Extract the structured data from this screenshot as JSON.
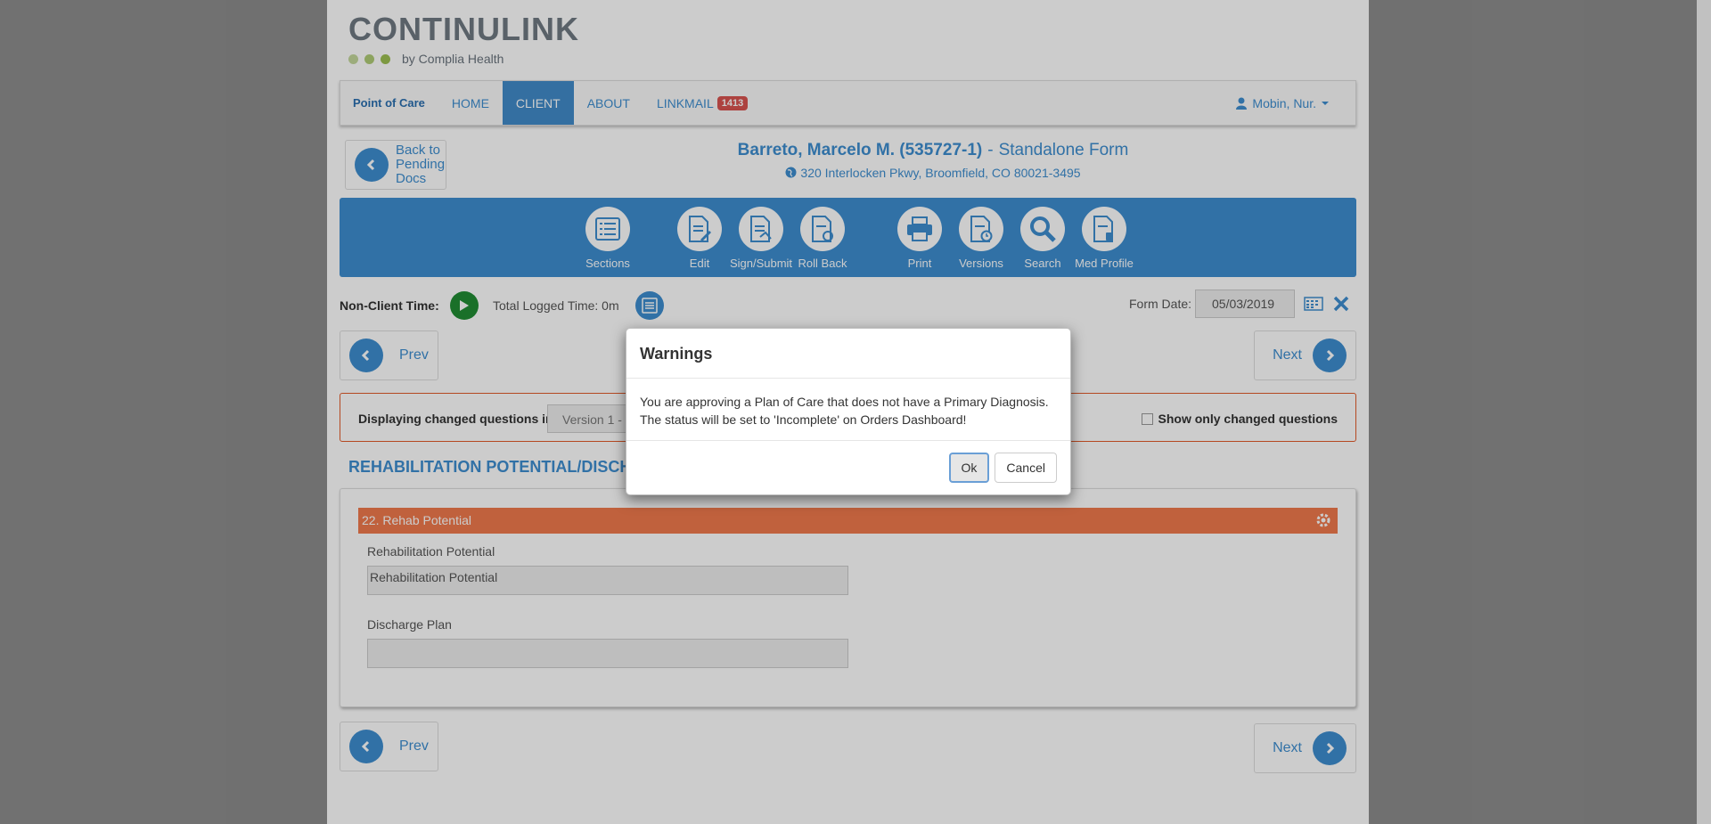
{
  "logo": {
    "name": "CONTINULINK",
    "by": "by Complia Health",
    "dot_colors": [
      "#c4d79c",
      "#b0cc77",
      "#9dc052"
    ]
  },
  "navbar": {
    "brand": "Point of Care",
    "items": [
      {
        "label": "HOME"
      },
      {
        "label": "CLIENT",
        "active": true
      },
      {
        "label": "ABOUT"
      },
      {
        "label": "LINKMAIL"
      }
    ],
    "linkmail_count": "1413",
    "user": "Mobin, Nur."
  },
  "back": {
    "label_line1": "Back to",
    "label_line2": "Pending",
    "label_line3": "Docs"
  },
  "patient": {
    "name": "Barreto, Marcelo M. (535727-1)",
    "separator": "-",
    "form": "Standalone Form",
    "address": "320 Interlocken Pkwy, Broomfield, CO 80021-3495"
  },
  "toolbar": {
    "items": [
      {
        "label": "Sections",
        "icon": "list-icon"
      },
      {
        "label": "Edit",
        "icon": "edit-doc-icon"
      },
      {
        "label": "Sign/Submit",
        "icon": "sign-doc-icon"
      },
      {
        "label": "Roll Back",
        "icon": "rollback-doc-icon"
      },
      {
        "label": "Print",
        "icon": "print-icon"
      },
      {
        "label": "Versions",
        "icon": "versions-icon"
      },
      {
        "label": "Search",
        "icon": "search-icon"
      },
      {
        "label": "Med Profile",
        "icon": "med-profile-icon"
      }
    ]
  },
  "timer": {
    "non_client_label": "Non-Client Time:",
    "logged": "Total Logged Time: 0m",
    "form_date_label": "Form Date:",
    "form_date": "05/03/2019"
  },
  "paging": {
    "prev": "Prev",
    "next": "Next"
  },
  "changed": {
    "label": "Displaying changed questions in:",
    "version": "Version 1 -",
    "show_only": "Show only changed questions"
  },
  "section": {
    "title": "REHABILITATION POTENTIAL/DISCHA",
    "question_header": "22. Rehab Potential",
    "fields": [
      {
        "label": "Rehabilitation Potential",
        "value": "Rehabilitation Potential"
      },
      {
        "label": "Discharge Plan",
        "value": ""
      }
    ]
  },
  "modal": {
    "title": "Warnings",
    "line1": "You are approving a Plan of Care that does not have a Primary Diagnosis.",
    "line2": "The status will be set to 'Incomplete' on Orders Dashboard!",
    "ok": "Ok",
    "cancel": "Cancel"
  },
  "colors": {
    "accent": "#3e8ed0",
    "warning": "#f07a4d",
    "badge": "#d9534f",
    "play": "#218d34"
  }
}
